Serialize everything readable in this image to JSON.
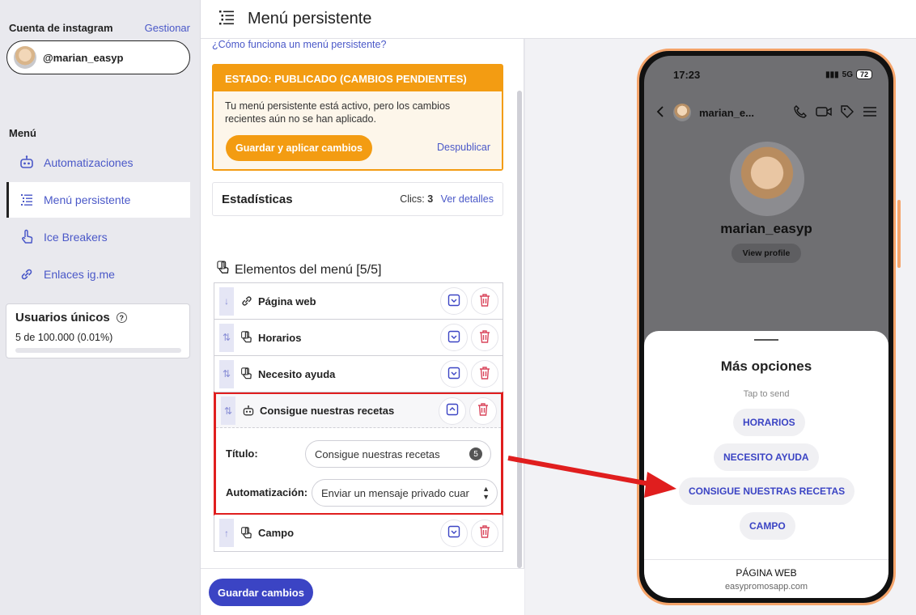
{
  "sidebar": {
    "account_label": "Cuenta de instagram",
    "manage_link": "Gestionar",
    "username": "@marian_easyp",
    "menu_heading": "Menú",
    "items": [
      {
        "label": "Automatizaciones",
        "icon": "robot-icon"
      },
      {
        "label": "Menú persistente",
        "icon": "list-icon",
        "active": true
      },
      {
        "label": "Ice Breakers",
        "icon": "hand-pointer-icon"
      },
      {
        "label": "Enlaces ig.me",
        "icon": "link-icon"
      }
    ],
    "unique_users": {
      "title": "Usuarios únicos",
      "value": "5 de 100.000 (0.01%)",
      "fraction": 0.0001
    }
  },
  "header": {
    "title": "Menú persistente"
  },
  "main": {
    "how_link": "¿Cómo funciona un menú persistente?",
    "status": {
      "title": "ESTADO: PUBLICADO (CAMBIOS PENDIENTES)",
      "message": "Tu menú persistente está activo, pero los cambios recientes aún no se han aplicado.",
      "apply_button": "Guardar y aplicar cambios",
      "unpublish_link": "Despublicar"
    },
    "stats": {
      "title": "Estadísticas",
      "clicks_label": "Clics:",
      "clicks_value": "3",
      "details_link": "Ver detalles"
    },
    "elements_heading": "Elementos del menú [5/5]",
    "elements": [
      {
        "label": "Página web",
        "icon": "link-icon",
        "drag": "↓"
      },
      {
        "label": "Horarios",
        "icon": "hand-pointer-icon",
        "drag": "⇅"
      },
      {
        "label": "Necesito ayuda",
        "icon": "hand-pointer-icon",
        "drag": "⇅"
      },
      {
        "label": "Consigue nuestras recetas",
        "icon": "robot-icon",
        "drag": "⇅",
        "expanded": true,
        "title_label": "Título:",
        "title_value": "Consigue nuestras recetas",
        "title_count": "5",
        "automation_label": "Automatización:",
        "automation_value": "Enviar un mensaje privado cuar"
      },
      {
        "label": "Campo",
        "icon": "hand-pointer-icon",
        "drag": "↑"
      }
    ],
    "save_button": "Guardar cambios"
  },
  "preview": {
    "time": "17:23",
    "network": "5G",
    "battery": "72",
    "chat_name": "marian_e...",
    "profile_name": "marian_easyp",
    "view_profile": "View profile",
    "sheet_title": "Más opciones",
    "tap_to_send": "Tap to send",
    "quick_replies": [
      "HORARIOS",
      "NECESITO AYUDA",
      "CONSIGUE NUESTRAS RECETAS",
      "CAMPO"
    ],
    "web_title": "PÁGINA WEB",
    "web_url": "easypromosapp.com"
  },
  "colors": {
    "accent": "#4a58c8",
    "warning": "#f39c12",
    "highlight": "#e01e1e",
    "primary_button": "#3b44c4"
  }
}
